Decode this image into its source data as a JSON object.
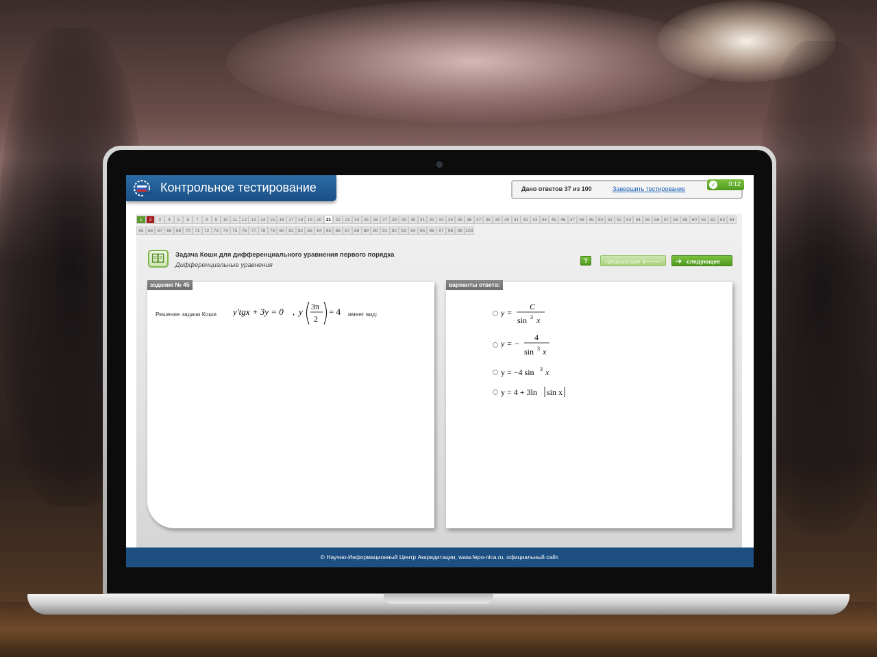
{
  "app": {
    "title": "Контрольное тестирование",
    "answers_status": "Дано ответов 37 из 100",
    "finish_link": "Завершить тестирование",
    "timer": "0:12"
  },
  "colors": {
    "brand_blue": "#1d4f82",
    "accent_green": "#5c9a2c",
    "wrong_red": "#a31c1c"
  },
  "question_nav": {
    "row1": [
      "1",
      "2",
      "3",
      "4",
      "5",
      "6",
      "7",
      "8",
      "9",
      "10",
      "11",
      "12",
      "13",
      "14",
      "15",
      "16",
      "17",
      "18",
      "19",
      "20",
      "21",
      "22",
      "23",
      "24",
      "25",
      "26",
      "27",
      "28",
      "29",
      "30",
      "31",
      "32",
      "33",
      "34",
      "35",
      "36",
      "37",
      "38",
      "39",
      "40",
      "41",
      "42",
      "43",
      "44",
      "45",
      "46",
      "47",
      "48",
      "49",
      "50",
      "51",
      "52",
      "53",
      "54",
      "55",
      "56",
      "57",
      "58",
      "59",
      "60",
      "61",
      "62",
      "63",
      "64"
    ],
    "row2": [
      "65",
      "66",
      "67",
      "68",
      "69",
      "70",
      "71",
      "72",
      "73",
      "74",
      "75",
      "76",
      "77",
      "78",
      "79",
      "80",
      "81",
      "82",
      "83",
      "84",
      "85",
      "86",
      "87",
      "88",
      "89",
      "90",
      "91",
      "92",
      "93",
      "94",
      "95",
      "96",
      "97",
      "98",
      "99",
      "100"
    ],
    "answered": [
      "1"
    ],
    "wrong": [
      "2"
    ],
    "current": "21"
  },
  "task": {
    "title": "Задача Коши для дифференциального уравнения первого порядка",
    "subtitle": "Дифференциальные уравнения",
    "number_label": "задание № 45",
    "text_before": "Решение задачи Коши",
    "text_after": "имеет вид:",
    "formula": {
      "lhs": "y′tgx + 3y = 0",
      "comma": ",",
      "y": "y",
      "num": "3π",
      "den": "2",
      "rhs": "= 4"
    }
  },
  "buttons": {
    "help": "?",
    "prev": "предыдущее",
    "next": "следующее",
    "prev_icon": "arrow-left-icon",
    "next_icon": "arrow-right-icon"
  },
  "answers": {
    "label": "варианты ответа:",
    "options": [
      {
        "prefix": "y =",
        "num": "C",
        "den": "sin",
        "exp": "3",
        "var": "x"
      },
      {
        "prefix": "y = −",
        "num": "4",
        "den": "sin",
        "exp": "3",
        "var": "x"
      },
      {
        "prefix": "y = −4 sin",
        "exp": "3",
        "var": "x"
      },
      {
        "prefix": "y = 4 + 3ln",
        "abs": "sin x"
      }
    ]
  },
  "footer": {
    "text": "© Научно-Информационный Центр Аккредитации, www.fepo-nica.ru, официальный сайт."
  }
}
